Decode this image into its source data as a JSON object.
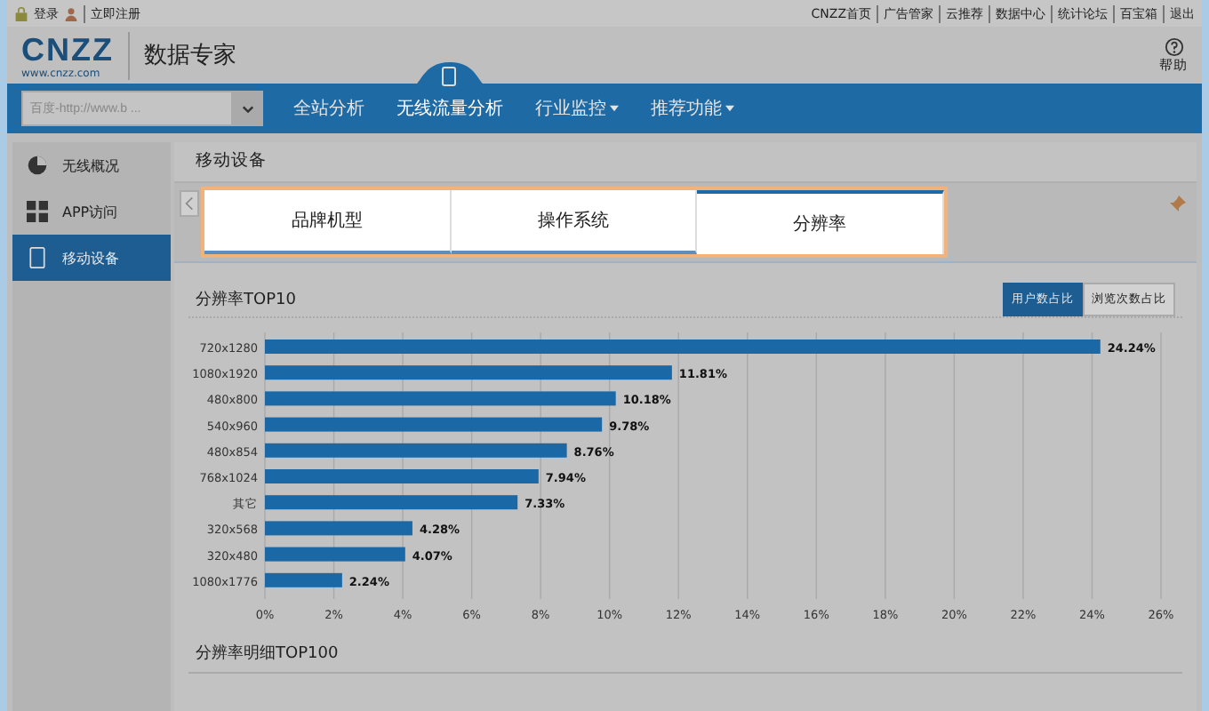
{
  "top_bar": {
    "left_links": [
      "登录",
      "立即注册"
    ],
    "right_links": [
      "CNZZ首页",
      "广告管家",
      "云推荐",
      "数据中心",
      "统计论坛",
      "百宝箱",
      "退出"
    ]
  },
  "header": {
    "logo": "CNZZ",
    "logo_url": "www.cnzz.com",
    "product": "数据专家",
    "help": "帮助"
  },
  "nav": {
    "site_select": {
      "placeholder": "百度-http://www.b ..."
    },
    "items": [
      {
        "label": "全站分析",
        "selected": false,
        "dropdown": false
      },
      {
        "label": "无线流量分析",
        "selected": true,
        "dropdown": false
      },
      {
        "label": "行业监控",
        "selected": false,
        "dropdown": true
      },
      {
        "label": "推荐功能",
        "selected": false,
        "dropdown": true
      }
    ]
  },
  "sidebar": {
    "items": [
      {
        "label": "无线概况",
        "kind": "pie",
        "selected": false
      },
      {
        "label": "APP访问",
        "kind": "grid",
        "selected": false
      },
      {
        "label": "移动设备",
        "kind": "phone",
        "selected": true
      }
    ]
  },
  "page_title": "移动设备",
  "tabs": [
    {
      "label": "品牌机型",
      "selected": false
    },
    {
      "label": "操作系统",
      "selected": false
    },
    {
      "label": "分辨率",
      "selected": true
    }
  ],
  "chart_panel": {
    "title": "分辨率TOP10",
    "toggles": [
      {
        "label": "用户数占比",
        "selected": true
      },
      {
        "label": "浏览次数占比",
        "selected": false
      }
    ],
    "chart_data": {
      "type": "bar",
      "orientation": "horizontal",
      "categories": [
        "720x1280",
        "1080x1920",
        "480x800",
        "540x960",
        "480x854",
        "768x1024",
        "其它",
        "320x568",
        "320x480",
        "1080x1776"
      ],
      "values": [
        24.24,
        11.81,
        10.18,
        9.78,
        8.76,
        7.94,
        7.33,
        4.28,
        4.07,
        2.24
      ],
      "value_labels": [
        "24.24%",
        "11.81%",
        "10.18%",
        "9.78%",
        "8.76%",
        "7.94%",
        "7.33%",
        "4.28%",
        "4.07%",
        "2.24%"
      ],
      "xlim": [
        0,
        26
      ],
      "grid": true,
      "xticks": [
        {
          "value": 0,
          "label": "0%"
        },
        {
          "value": 2,
          "label": "2%"
        },
        {
          "value": 4,
          "label": "4%"
        },
        {
          "value": 6,
          "label": "6%"
        },
        {
          "value": 8,
          "label": "8%"
        },
        {
          "value": 10,
          "label": "10%"
        },
        {
          "value": 12,
          "label": "12%"
        },
        {
          "value": 14,
          "label": "14%"
        },
        {
          "value": 16,
          "label": "16%"
        },
        {
          "value": 18,
          "label": "18%"
        },
        {
          "value": 20,
          "label": "20%"
        },
        {
          "value": 22,
          "label": "22%"
        },
        {
          "value": 24,
          "label": "24%"
        },
        {
          "value": 26,
          "label": "26%"
        }
      ]
    }
  },
  "detail_title": "分辨率明细TOP100"
}
